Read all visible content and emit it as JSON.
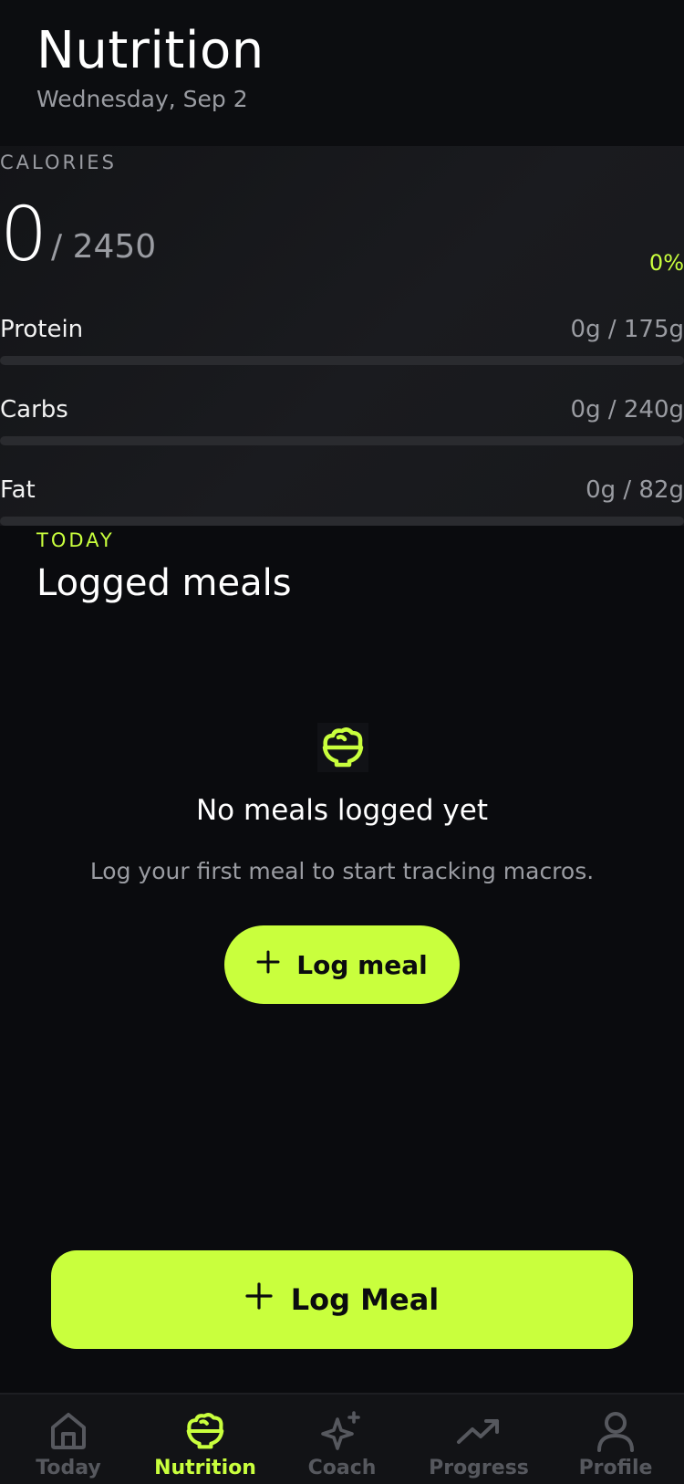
{
  "header": {
    "title": "Nutrition",
    "date": "Wednesday, Sep 2"
  },
  "calories": {
    "label": "CALORIES",
    "current": "0",
    "goal": "/ 2450",
    "percent": "0%",
    "progress_fraction": 0
  },
  "macros": [
    {
      "label": "Protein",
      "value": "0g / 175g",
      "progress_fraction": 0
    },
    {
      "label": "Carbs",
      "value": "0g / 240g",
      "progress_fraction": 0
    },
    {
      "label": "Fat",
      "value": "0g / 82g",
      "progress_fraction": 0
    }
  ],
  "meals": {
    "eyebrow": "TODAY",
    "title": "Logged meals",
    "empty_icon": "salad-bowl-icon",
    "empty_title": "No meals logged yet",
    "empty_text": "Log your first meal to start tracking macros.",
    "inline_button": "Log meal"
  },
  "primary_button": "Log Meal",
  "tabs": [
    {
      "label": "Today",
      "icon": "home-icon",
      "active": false
    },
    {
      "label": "Nutrition",
      "icon": "salad-bowl-icon",
      "active": true
    },
    {
      "label": "Coach",
      "icon": "sparkles-icon",
      "active": false
    },
    {
      "label": "Progress",
      "icon": "trending-up-icon",
      "active": false
    },
    {
      "label": "Profile",
      "icon": "user-icon",
      "active": false
    }
  ],
  "colors": {
    "background": "#0a0b0e",
    "accent": "#c9ff3d",
    "muted_text": "#9a9ca2",
    "inactive_tab": "#56585e"
  }
}
